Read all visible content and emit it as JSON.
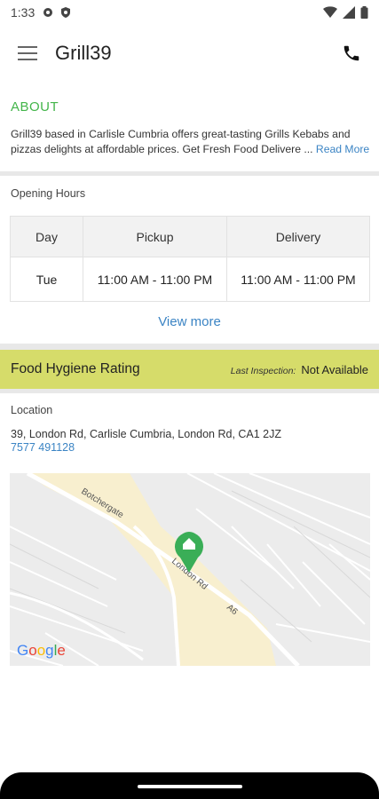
{
  "status_bar": {
    "time": "1:33"
  },
  "app_bar": {
    "title": "Grill39"
  },
  "about": {
    "heading": "ABOUT",
    "text": "Grill39 based in Carlisle Cumbria offers great-tasting Grills Kebabs and pizzas delights at affordable prices. Get Fresh Food Delivere ... ",
    "read_more": "Read More"
  },
  "opening_hours": {
    "title": "Opening Hours",
    "headers": [
      "Day",
      "Pickup",
      "Delivery"
    ],
    "rows": [
      {
        "day": "Tue",
        "pickup": "11:00 AM - 11:00 PM",
        "delivery": "11:00 AM - 11:00 PM"
      }
    ],
    "view_more": "View more"
  },
  "hygiene": {
    "title": "Food Hygiene Rating",
    "last_inspection_label": "Last Inspection:",
    "last_inspection_value": "Not Available"
  },
  "location": {
    "title": "Location",
    "address": "39, London Rd, Carlisle Cumbria, London Rd, CA1 2JZ",
    "phone": "7577 491128",
    "map": {
      "street_botchergate": "Botchergate",
      "street_london_rd": "London Rd",
      "road_a6": "A6",
      "google_logo": "Google"
    }
  },
  "colors": {
    "accent_green": "#43b54a",
    "link_blue": "#3b84c4",
    "hygiene_bar": "#d6dc6a",
    "map_highlight": "#f8efcf"
  }
}
